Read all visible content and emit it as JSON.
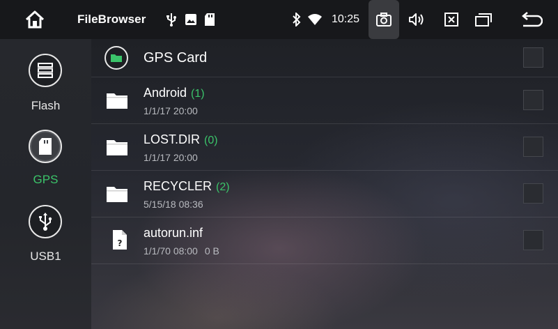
{
  "status_bar": {
    "title": "FileBrowser",
    "clock": "10:25",
    "icons": [
      "home-icon",
      "usb-icon",
      "image-icon",
      "sd-card-icon",
      "bluetooth-icon",
      "wifi-icon",
      "camera-icon",
      "volume-icon",
      "close-window-icon",
      "recent-apps-icon",
      "back-icon"
    ]
  },
  "sidebar": {
    "items": [
      {
        "label": "Flash",
        "icon": "storage-icon",
        "active": false
      },
      {
        "label": "GPS",
        "icon": "sd-card-icon",
        "active": true
      },
      {
        "label": "USB1",
        "icon": "usb-icon",
        "active": false
      }
    ]
  },
  "main": {
    "header": {
      "title": "GPS Card",
      "icon": "folder-icon"
    },
    "files": [
      {
        "name": "Android",
        "count": "(1)",
        "date": "1/1/17 20:00",
        "size": "",
        "type": "folder"
      },
      {
        "name": "LOST.DIR",
        "count": "(0)",
        "date": "1/1/17 20:00",
        "size": "",
        "type": "folder"
      },
      {
        "name": "RECYCLER",
        "count": "(2)",
        "date": "5/15/18 08:36",
        "size": "",
        "type": "folder"
      },
      {
        "name": "autorun.inf",
        "count": "",
        "date": "1/1/70 08:00",
        "size": "0 B",
        "type": "unknown-file"
      }
    ]
  },
  "colors": {
    "accent": "#3bc46a",
    "status_bg": "#17181b",
    "sidebar_bg": "#26282d"
  }
}
